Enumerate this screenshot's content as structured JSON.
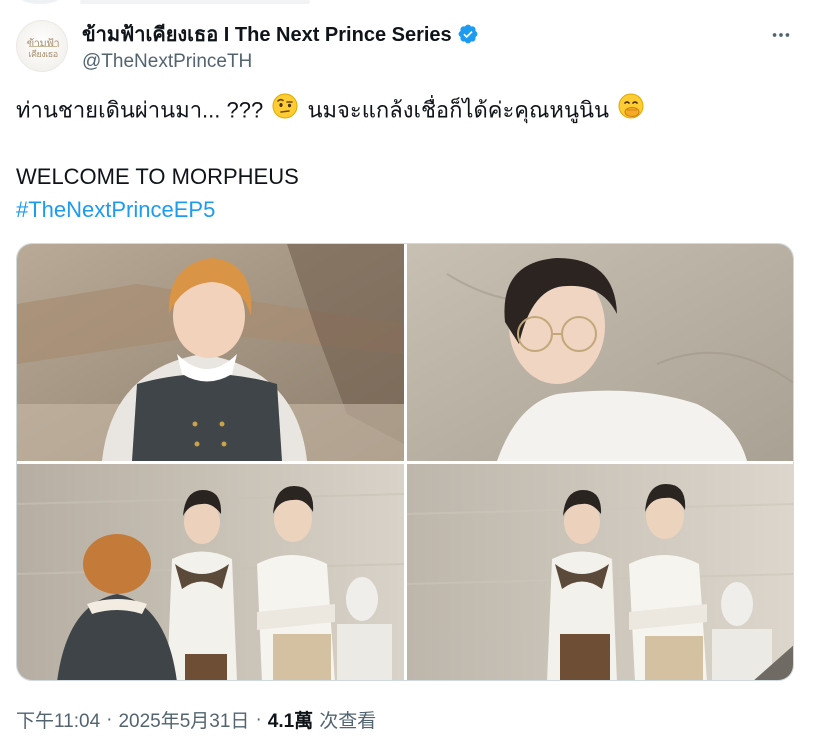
{
  "post": {
    "author": {
      "display_name": "ข้ามฟ้าเคียงเธอ I The Next Prince Series",
      "handle": "@TheNextPrinceTH",
      "verified": true,
      "avatar_logo_line1": "ข้ามฟ้า",
      "avatar_logo_line2": "เคียงเธอ",
      "verified_color": "#1d9bf0"
    },
    "more_icon": "more-horizontal-icon",
    "text_part1": "ท่านชายเดินผ่านมา... ???",
    "emoji_1": "face-with-raised-eyebrow",
    "text_part2": "นมจะแกล้งเชื่อก็ได้ค่ะคุณหนูนิน",
    "emoji_2": "face-with-hand-over-mouth",
    "line_welcome": "WELCOME TO MORPHEUS",
    "hashtag": "#TheNextPrinceEP5",
    "hashtag_color": "#1d9bf0",
    "media": [
      {
        "id": "photo-1",
        "subject": "young man with orange-blond hair in dark knit vest and ruffled white blouse"
      },
      {
        "id": "photo-2",
        "subject": "young man with dark hair wearing round glasses and white shirt, looking down"
      },
      {
        "id": "photo-3",
        "subject": "two men standing against marble wall, one with sweater over shoulders, one with glasses and crossed arms; orange-haired figure from behind"
      },
      {
        "id": "photo-4",
        "subject": "two men standing against marble wall near statue"
      }
    ],
    "meta": {
      "time": "下午11:04",
      "separator": "·",
      "date": "2025年5月31日",
      "views_count": "4.1萬",
      "views_label": "次查看"
    }
  },
  "colors": {
    "text_primary": "#0f1419",
    "text_secondary": "#536471",
    "border": "#cfd9de"
  }
}
